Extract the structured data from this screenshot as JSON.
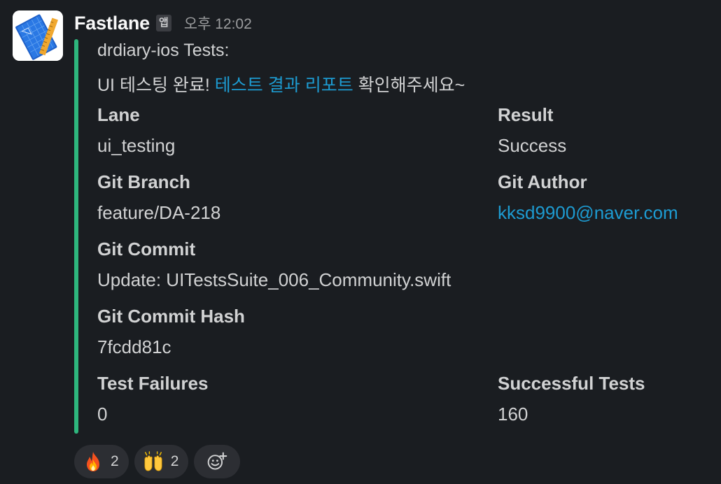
{
  "sender": {
    "name": "Fastlane",
    "badge": "앱",
    "timestamp": "오후 12:02",
    "avatar_icon": "xcode-blueprint-icon"
  },
  "attachment": {
    "accent_color": "#2eb67d",
    "line1": "drdiary-ios Tests:",
    "line2_prefix": "UI 테스팅 완료! ",
    "line2_link": "테스트 결과 리포트",
    "line2_suffix": " 확인해주세요~",
    "link_color": "#1d9bd1",
    "fields": {
      "lane": {
        "title": "Lane",
        "value": "ui_testing"
      },
      "result": {
        "title": "Result",
        "value": "Success"
      },
      "git_branch": {
        "title": "Git Branch",
        "value": "feature/DA-218"
      },
      "git_author": {
        "title": "Git Author",
        "value": "kksd9900@naver.com"
      },
      "git_commit": {
        "title": "Git Commit",
        "value": "Update: UITestsSuite_006_Community.swift"
      },
      "git_commit_hash": {
        "title": "Git Commit Hash",
        "value": "7fcdd81c"
      },
      "test_failures": {
        "title": "Test Failures",
        "value": "0"
      },
      "successful_tests": {
        "title": "Successful Tests",
        "value": "160"
      }
    }
  },
  "reactions": [
    {
      "icon": "fire-emoji-icon",
      "count": "2"
    },
    {
      "icon": "raising-hands-emoji-icon",
      "count": "2"
    }
  ],
  "add_reaction_icon": "add-reaction-icon"
}
